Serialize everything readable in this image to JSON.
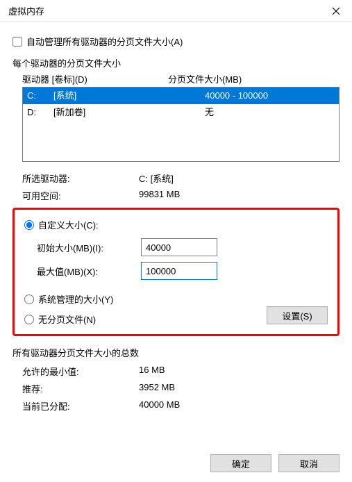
{
  "window": {
    "title": "虚拟内存"
  },
  "auto_manage": {
    "label": "自动管理所有驱动器的分页文件大小(A)",
    "checked": false
  },
  "per_drive_label": "每个驱动器的分页文件大小",
  "header": {
    "drive": "驱动器 [卷标](D)",
    "page": "分页文件大小(MB)"
  },
  "drives": [
    {
      "letter": "C:",
      "label": "[系统]",
      "page": "40000 - 100000",
      "selected": true
    },
    {
      "letter": "D:",
      "label": "[新加卷]",
      "page": "无",
      "selected": false
    }
  ],
  "selected_drive": {
    "label": "所选驱动器:",
    "value": "C:  [系统]"
  },
  "available": {
    "label": "可用空间:",
    "value": "99831 MB"
  },
  "custom": {
    "label": "自定义大小(C):",
    "initial_label": "初始大小(MB)(I):",
    "initial_value": "40000",
    "max_label": "最大值(MB)(X):",
    "max_value": "100000"
  },
  "sys_managed_label": "系统管理的大小(Y)",
  "no_page_label": "无分页文件(N)",
  "set_button": "设置(S)",
  "summary": {
    "title": "所有驱动器分页文件大小的总数",
    "min_label": "允许的最小值:",
    "min_value": "16 MB",
    "rec_label": "推荐:",
    "rec_value": "3952 MB",
    "cur_label": "当前已分配:",
    "cur_value": "40000 MB"
  },
  "buttons": {
    "ok": "确定",
    "cancel": "取消"
  }
}
